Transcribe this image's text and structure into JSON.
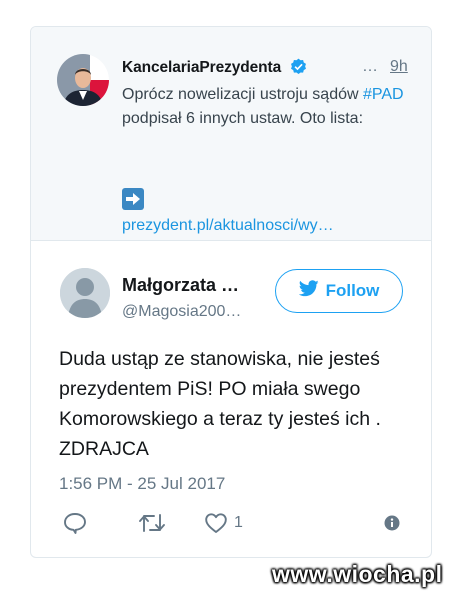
{
  "quoted_tweet": {
    "author_name": "KancelariaPrezydenta",
    "ellipsis": "…",
    "time": "9h",
    "text_before_hashtag": "Oprócz nowelizacji ustroju sądów ",
    "hashtag": "#PAD",
    "text_after_hashtag": " podpisał 6 innych ustaw. Oto lista:",
    "link": "prezydent.pl/aktualnosci/wy…",
    "icons": [
      "verified-badge-icon",
      "right-arrow-icon"
    ]
  },
  "tweet": {
    "author_name": "Małgorzata …",
    "author_handle": "@Magosia200…",
    "follow_label": "Follow",
    "text": "Duda ustąp ze stanowiska, nie jesteś prezydentem PiS! PO miała swego Komorowskiego a teraz ty jesteś ich . ZDRAJCA",
    "timestamp": "1:56 PM - 25 Jul 2017",
    "like_count": "1",
    "icons": [
      "reply-icon",
      "retweet-icon",
      "like-icon",
      "info-icon",
      "twitter-bird-icon"
    ]
  },
  "watermark": "www.wiocha.pl",
  "colors": {
    "link_blue": "#1b95e0",
    "follow_blue": "#1da1f2",
    "muted_gray": "#657786",
    "quoted_bg": "#f5f8fa",
    "arrow_box_blue": "#3b88c3"
  }
}
